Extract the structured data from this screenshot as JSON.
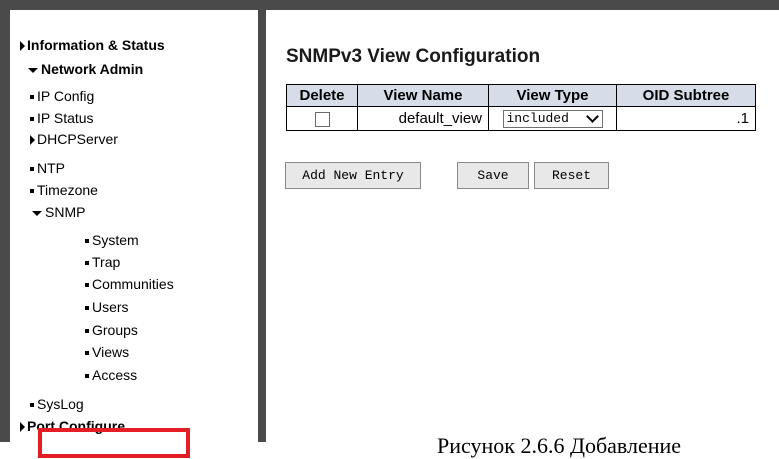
{
  "sidebar": {
    "information_status": "Information & Status",
    "network_admin": "Network Admin",
    "ip_config": "IP Config",
    "ip_status": "IP Status",
    "dhcp_server": "DHCPServer",
    "ntp": "NTP",
    "timezone": "Timezone",
    "snmp": "SNMP",
    "snmp_system": "System",
    "snmp_trap": "Trap",
    "snmp_communities": "Communities",
    "snmp_users": "Users",
    "snmp_groups": "Groups",
    "snmp_views": "Views",
    "snmp_access": "Access",
    "syslog": "SysLog",
    "port_configure": "Port Configure"
  },
  "main": {
    "title": "SNMPv3 View Configuration",
    "table": {
      "headers": [
        "Delete",
        "View Name",
        "View Type",
        "OID Subtree"
      ],
      "rows": [
        {
          "delete_checked": false,
          "view_name": "default_view",
          "view_type": "included",
          "oid_subtree": ".1"
        }
      ]
    },
    "buttons": {
      "add_new_entry": "Add New Entry",
      "save": "Save",
      "reset": "Reset"
    }
  },
  "caption": "Рисунок 2.6.6 Добавление",
  "colors": {
    "frame": "#4a4a4a",
    "table_header_bg": "#d7dde8",
    "highlight_box": "#e31e24"
  }
}
